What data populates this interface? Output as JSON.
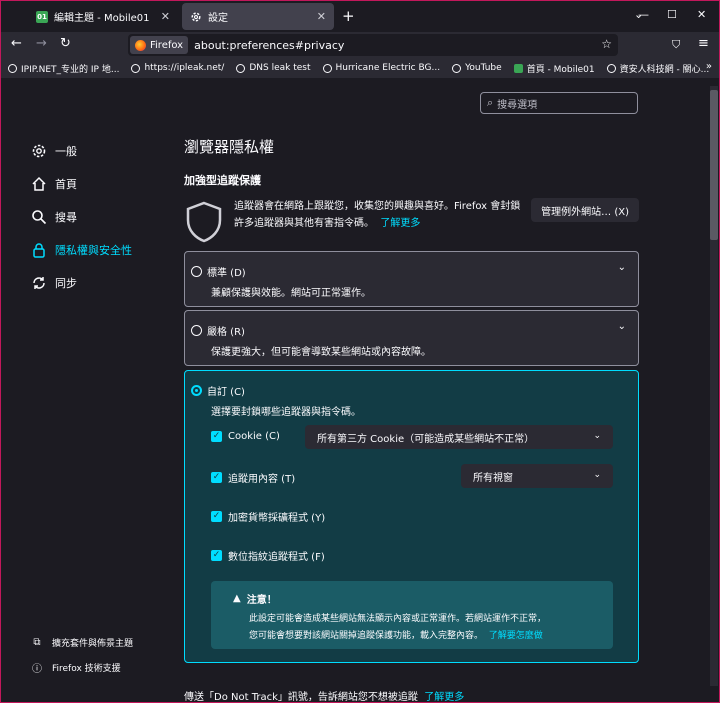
{
  "tabs": [
    {
      "title": "編輯主題 - Mobile01",
      "favicon": "mobile01-icon"
    },
    {
      "title": "設定",
      "favicon": "gear-icon"
    }
  ],
  "nav": {
    "identity_label": "Firefox",
    "url": "about:preferences#privacy"
  },
  "bookmarks": [
    {
      "label": "IPIP.NET_专业的 IP 地..."
    },
    {
      "label": "https://ipleak.net/"
    },
    {
      "label": "DNS leak test"
    },
    {
      "label": "Hurricane Electric BG..."
    },
    {
      "label": "YouTube"
    },
    {
      "label": "首頁 - Mobile01"
    },
    {
      "label": "資安人科技網 - 關心..."
    }
  ],
  "search": {
    "placeholder": "搜尋選項"
  },
  "sidebar": {
    "items": [
      {
        "label": "一般",
        "icon": "gear-icon"
      },
      {
        "label": "首頁",
        "icon": "home-icon"
      },
      {
        "label": "搜尋",
        "icon": "search-icon"
      },
      {
        "label": "隱私權與安全性",
        "icon": "lock-icon"
      },
      {
        "label": "同步",
        "icon": "sync-icon"
      }
    ],
    "bottom": [
      {
        "label": "擴充套件與佈景主題",
        "icon": "puzzle-icon"
      },
      {
        "label": "Firefox 技術支援",
        "icon": "help-icon"
      }
    ]
  },
  "main": {
    "title": "瀏覽器隱私權",
    "etp_heading": "加強型追蹤保護",
    "etp_desc": "追蹤器會在網路上跟蹤您，收集您的興趣與喜好。Firefox 會封鎖許多追蹤器與其他有害指令碼。",
    "learn_more": "了解更多",
    "exceptions_button": "管理例外網站… (X)",
    "standard": {
      "title": "標準 (D)",
      "desc": "兼顧保護與效能。網站可正常運作。"
    },
    "strict": {
      "title": "嚴格 (R)",
      "desc": "保護更強大，但可能會導致某些網站或內容故障。"
    },
    "custom": {
      "title": "自訂 (C)",
      "desc": "選擇要封鎖哪些追蹤器與指令碼。",
      "cookie_label": "Cookie (C)",
      "cookie_value": "所有第三方 Cookie（可能造成某些網站不正常）",
      "tracking_label": "追蹤用內容 (T)",
      "tracking_value": "所有視窗",
      "crypto_label": "加密貨幣採礦程式 (Y)",
      "finger_label": "數位指紋追蹤程式 (F)",
      "warning_title": "注意！",
      "warning_line1": "此設定可能會造成某些網站無法顯示內容或正常運作。若網站運作不正常，",
      "warning_line2": "您可能會想要對該網站關掉追蹤保護功能，載入完整內容。",
      "warning_link": "了解要怎麼做"
    },
    "dnt_text": "傳送「Do Not Track」訊號，告訴網站您不想被追蹤",
    "dnt_link": "了解更多"
  },
  "colors": {
    "accent": "#00ddff",
    "background": "#1c1b22",
    "card": "#2b2a33",
    "custom_card": "#123c45"
  }
}
